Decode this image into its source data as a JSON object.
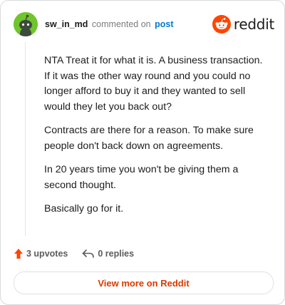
{
  "comment": {
    "username": "sw_in_md",
    "action_text": "commented on",
    "post_link": "post",
    "paragraphs": [
      "NTA Treat it for what it is. A business transaction. If it was the other way round and you could no longer afford to buy it and they wanted to sell would they let you back out?",
      "Contracts are there for a reason. To make sure people don't back down on agreements.",
      "In 20 years time you won't be giving them a second thought.",
      "Basically go for it."
    ],
    "upvotes": "3 upvotes",
    "replies": "0 replies"
  },
  "brand": {
    "name": "reddit",
    "color": "#ff4500"
  },
  "footer": {
    "view_label": "View more on Reddit"
  },
  "icons": {
    "avatar": "snoo-avatar-icon",
    "logo": "reddit-logo-icon",
    "upvote": "upvote-arrow-icon",
    "reply": "reply-arrow-icon"
  },
  "colors": {
    "avatar_bg": "#6fc52b",
    "upvote": "#ff4500",
    "link": "#0079d3",
    "view_button_text": "#d93a00"
  }
}
